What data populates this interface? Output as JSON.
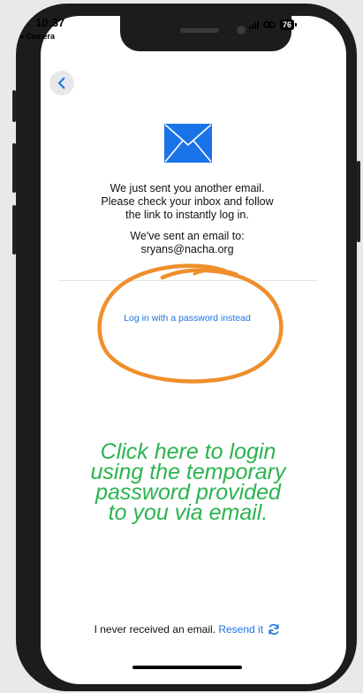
{
  "status_bar": {
    "time": "10:37",
    "back_app": "◂ Camera",
    "battery": "76"
  },
  "nav": {
    "back_icon": "chevron-left-icon"
  },
  "message": {
    "icon": "envelope-icon",
    "line1": "We just sent you another email.",
    "line2": "Please check your inbox and follow",
    "line3": "the link to instantly log in.",
    "sent_to_label": "We've sent an email to:",
    "email": "sryans@nacha.org"
  },
  "password_link": "Log in with a password instead",
  "annotation": {
    "lines": [
      "Click here to login",
      "using the temporary",
      "password provided",
      "to you via email."
    ],
    "color": "#2bb34f",
    "circle_color": "#ef8f2b"
  },
  "footer": {
    "prompt": "I never received an email.",
    "resend_label": "Resend it",
    "resend_icon": "refresh-icon"
  },
  "colors": {
    "link": "#1a73e8",
    "email_icon": "#1a73e8"
  }
}
